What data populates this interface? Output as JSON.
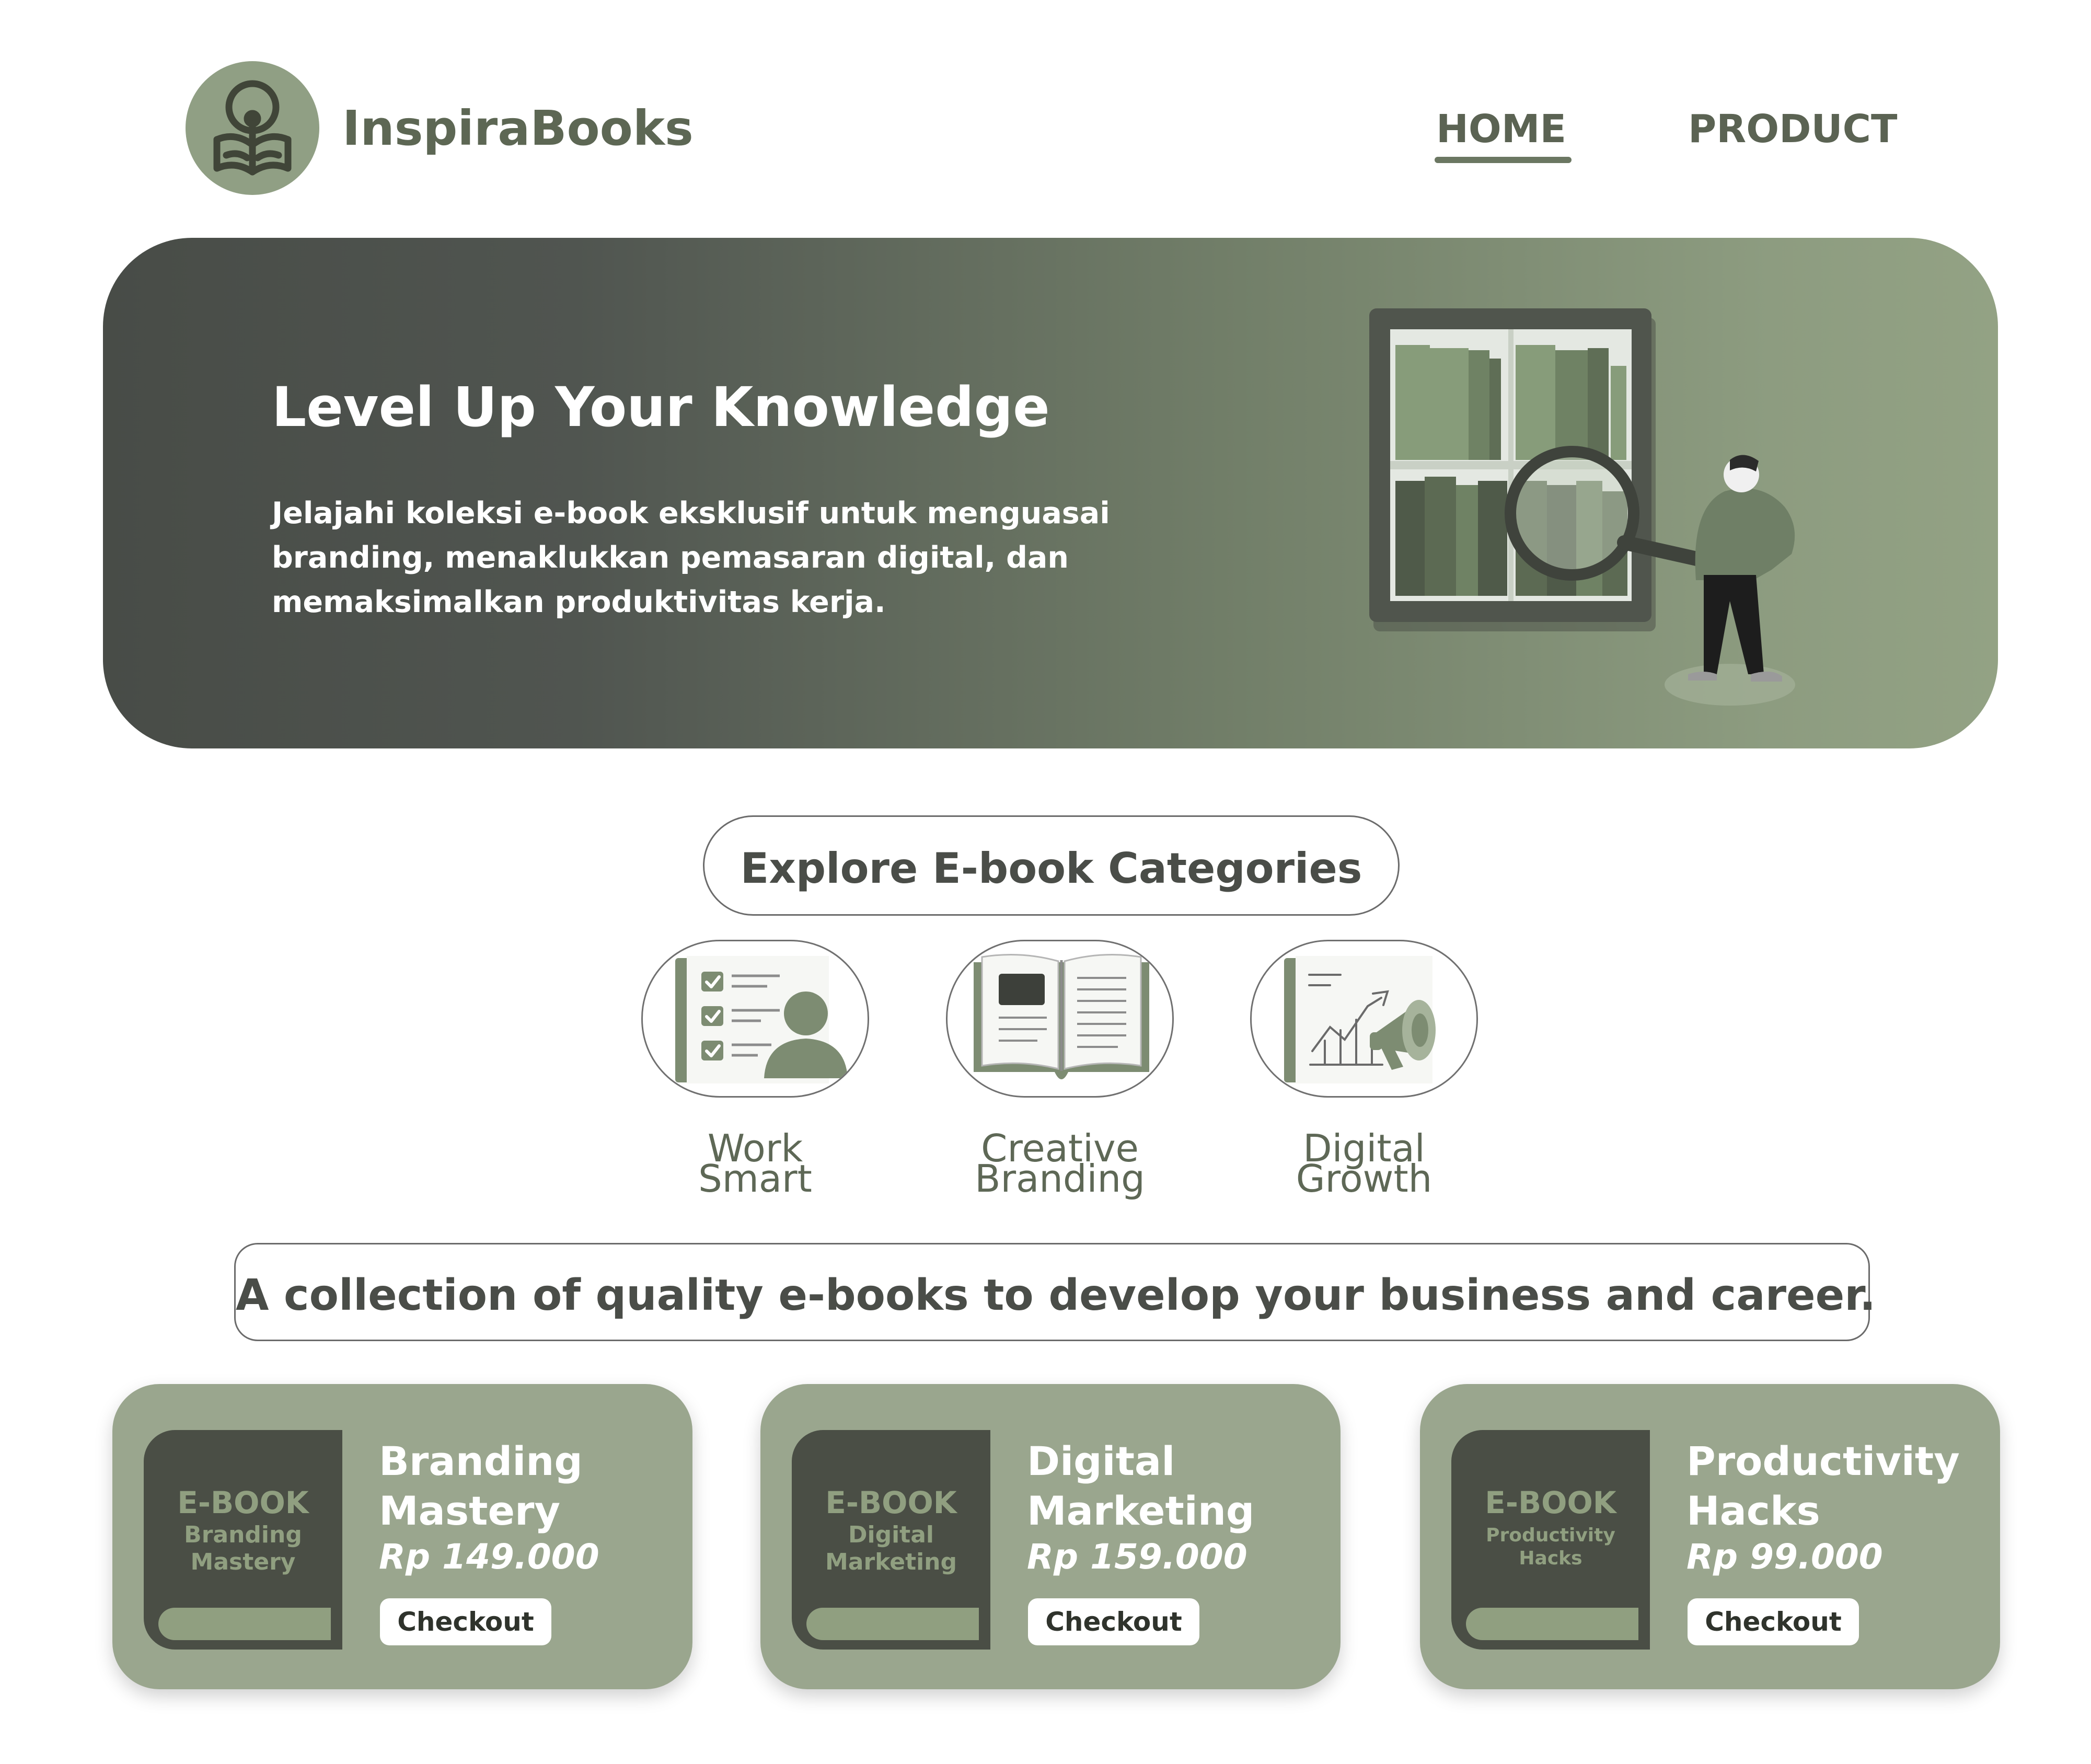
{
  "brand": {
    "name": "InspiraBooks"
  },
  "nav": {
    "home": "HOME",
    "product": "PRODUCT"
  },
  "hero": {
    "title": "Level Up Your Knowledge",
    "description": "Jelajahi koleksi e-book eksklusif untuk menguasai branding, menaklukkan pemasaran digital, dan memaksimalkan produktivitas kerja."
  },
  "categories": {
    "heading": "Explore E-book Categories",
    "items": [
      {
        "line1": "Work",
        "line2": "Smart",
        "icon": "checklist-person-icon"
      },
      {
        "line1": "Creative",
        "line2": "Branding",
        "icon": "open-book-icon"
      },
      {
        "line1": "Digital",
        "line2": "Growth",
        "icon": "growth-chart-megaphone-icon"
      }
    ]
  },
  "tagline": "A collection of quality e-books to develop your business and career.",
  "products": [
    {
      "cover_label": "E-BOOK",
      "cover_line1": "Branding",
      "cover_line2": "Mastery",
      "title_line1": "Branding",
      "title_line2": "Mastery",
      "price": "Rp 149.000",
      "cta": "Checkout"
    },
    {
      "cover_label": "E-BOOK",
      "cover_line1": "Digital",
      "cover_line2": "Marketing",
      "title_line1": "Digital",
      "title_line2": "Marketing",
      "price": "Rp 159.000",
      "cta": "Checkout"
    },
    {
      "cover_label": "E-BOOK",
      "cover_line1": "Productivity",
      "cover_line2": "Hacks",
      "title_line1": "Productivity",
      "title_line2": "Hacks",
      "price": "Rp 99.000",
      "cta": "Checkout"
    }
  ],
  "colors": {
    "accent": "#909f84",
    "dark": "#4a4e45",
    "card": "#9aa68e"
  }
}
